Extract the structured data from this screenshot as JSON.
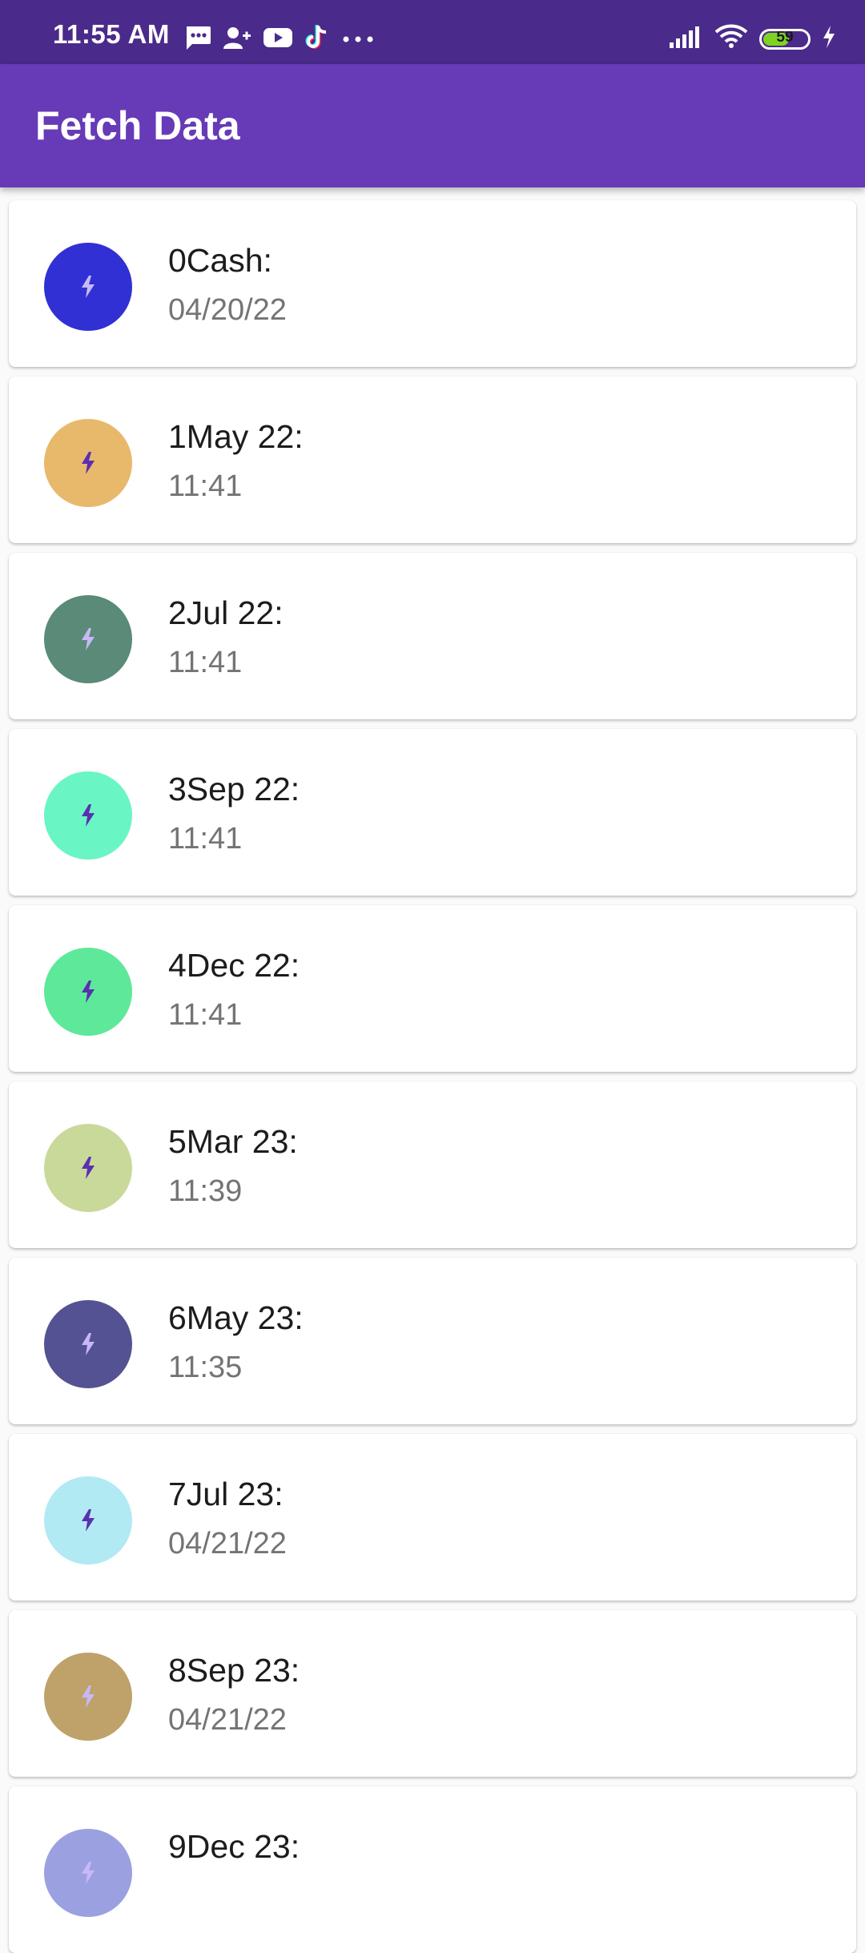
{
  "status_bar": {
    "time": "11:55 AM",
    "battery_level": "59",
    "battery_fraction": 0.59,
    "left_icons": [
      "message-icon",
      "add-contact-icon",
      "youtube-icon",
      "tiktok-icon",
      "more-dots-icon"
    ],
    "right_icons": [
      "signal-icon",
      "wifi-icon",
      "battery-icon",
      "charging-bolt-icon"
    ]
  },
  "app_bar": {
    "title": "Fetch Data",
    "color": "#673ab7"
  },
  "items": [
    {
      "title": "0Cash:",
      "subtitle": "04/20/22",
      "avatar_color": "#3130d4",
      "icon_color": "#c8b8f8"
    },
    {
      "title": "1May 22:",
      "subtitle": "11:41",
      "avatar_color": "#e8b86b",
      "icon_color": "#5b2fb0"
    },
    {
      "title": "2Jul 22:",
      "subtitle": "11:41",
      "avatar_color": "#5a8a78",
      "icon_color": "#c8b8f8"
    },
    {
      "title": "3Sep 22:",
      "subtitle": "11:41",
      "avatar_color": "#6af5c4",
      "icon_color": "#5b2fb0"
    },
    {
      "title": "4Dec 22:",
      "subtitle": "11:41",
      "avatar_color": "#5ee89a",
      "icon_color": "#5b2fb0"
    },
    {
      "title": "5Mar 23:",
      "subtitle": "11:39",
      "avatar_color": "#c8d99a",
      "icon_color": "#5b2fb0"
    },
    {
      "title": "6May 23:",
      "subtitle": "11:35",
      "avatar_color": "#545292",
      "icon_color": "#c8b8f8"
    },
    {
      "title": "7Jul 23:",
      "subtitle": "04/21/22",
      "avatar_color": "#b2eaf4",
      "icon_color": "#5b2fb0"
    },
    {
      "title": "8Sep 23:",
      "subtitle": "04/21/22",
      "avatar_color": "#bea26a",
      "icon_color": "#c8b8f8"
    },
    {
      "title": "9Dec 23:",
      "subtitle": "",
      "avatar_color": "#9ba0e0",
      "icon_color": "#c8b8f8"
    }
  ]
}
